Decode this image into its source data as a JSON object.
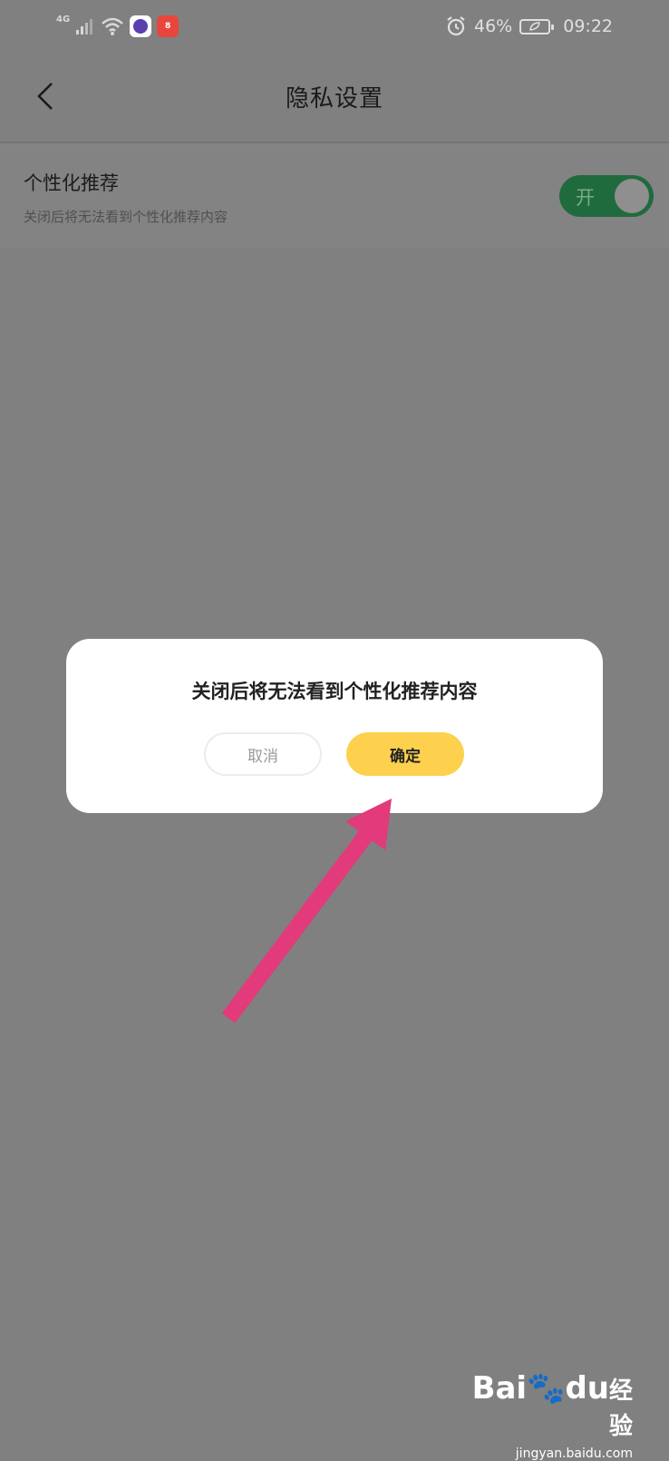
{
  "status_bar": {
    "network_type": "4G",
    "battery_percent": "46%",
    "time": "09:22",
    "red_app_text": "8"
  },
  "header": {
    "title": "隐私设置"
  },
  "setting": {
    "title": "个性化推荐",
    "description": "关闭后将无法看到个性化推荐内容",
    "toggle_label": "开"
  },
  "dialog": {
    "message": "关闭后将无法看到个性化推荐内容",
    "cancel_label": "取消",
    "confirm_label": "确定"
  },
  "annotation": {
    "arrow_color": "#e23a7b"
  },
  "watermark": {
    "logo_text": "Bai",
    "logo_mid": "du",
    "logo_suffix": "经验",
    "url": "jingyan.baidu.com"
  },
  "colors": {
    "overlay": "#808080",
    "confirm_button": "#fdd04e",
    "toggle_on": "#1f6b3e"
  }
}
